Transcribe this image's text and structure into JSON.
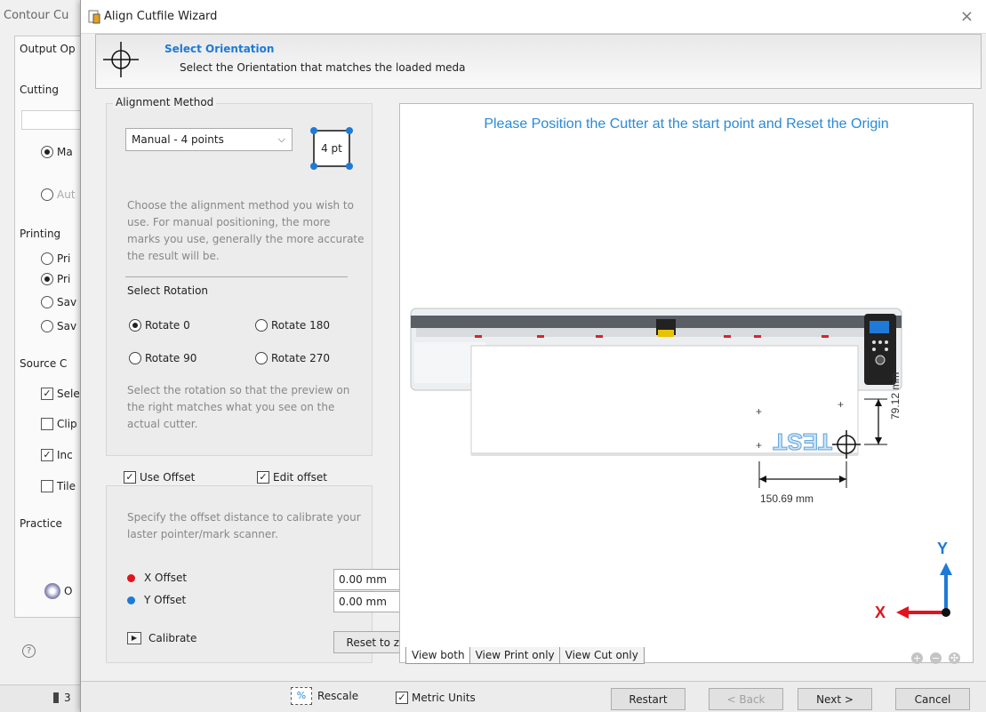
{
  "background_app": {
    "title": "Contour Cu",
    "groups": [
      "Output Op",
      "Cutting",
      "Printing",
      "Source C",
      "Practice"
    ],
    "controls": [
      "Ma",
      "Aut",
      "Pri",
      "Pri",
      "Sav",
      "Sav",
      "Sele",
      "Clip",
      "Inc",
      "Tile",
      "O"
    ],
    "footer_text": "3"
  },
  "dialog": {
    "title": "Align Cutfile Wizard",
    "close_glyph": "×"
  },
  "header": {
    "title": "Select Orientation",
    "subtitle": "Select the Orientation that matches the loaded meda"
  },
  "alignment": {
    "legend": "Alignment Method",
    "method_value": "Manual - 4 points",
    "points_label": "4 pt",
    "help_text": "Choose the alignment method you wish to use. For manual positioning, the more marks you use, generally the more accurate the result will be."
  },
  "rotation": {
    "label": "Select Rotation",
    "options": [
      "Rotate 0",
      "Rotate 180",
      "Rotate 90",
      "Rotate 270"
    ],
    "selected": "Rotate 0",
    "help_text": "Select the rotation so that the preview on the right matches what you see on the actual cutter."
  },
  "offset": {
    "use_offset_label": "Use Offset",
    "edit_offset_label": "Edit offset",
    "use_offset_checked": true,
    "edit_offset_checked": true,
    "help_text": "Specify the offset distance to calibrate your laster pointer/mark scanner.",
    "x_label": "X Offset",
    "x_value": "0.00 mm",
    "y_label": "Y Offset",
    "y_value": "0.00 mm",
    "calibrate_label": "Calibrate",
    "reset_label": "Reset to zero",
    "x_color": "#e0141e",
    "y_color": "#1e7ad6"
  },
  "preview": {
    "message": "Please Position the Cutter at the start point and Reset the Origin",
    "job_text": "TEST",
    "width_dim": "150.69 mm",
    "height_dim": "79.12 mm",
    "axis_x": "X",
    "axis_y": "Y",
    "tabs": [
      "View both",
      "View Print only",
      "View Cut only"
    ],
    "active_tab": "View both",
    "zoom_tools": [
      "zoom-in",
      "zoom-out",
      "zoom-fit"
    ]
  },
  "footer": {
    "rescale_label": "Rescale",
    "metric_label": "Metric Units",
    "metric_checked": true,
    "restart_label": "Restart",
    "back_label": "< Back",
    "next_label": "Next >",
    "cancel_label": "Cancel"
  },
  "colors": {
    "accent_blue": "#1e7ad6",
    "message_blue": "#2a8ad6",
    "arrow_red": "#e0141e"
  }
}
